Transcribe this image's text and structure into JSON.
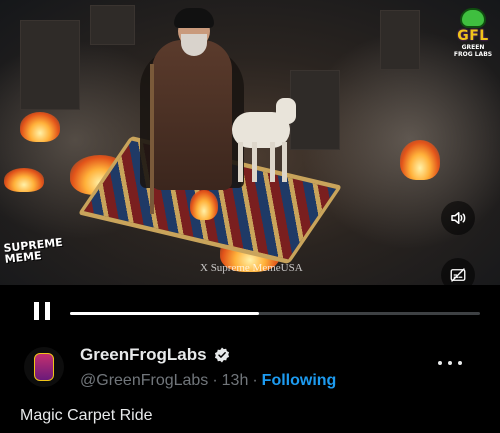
{
  "video": {
    "watermark": "X Supreme MemeUSA",
    "corner_logo": {
      "title": "GFL",
      "subtitle": "GREEN FROG LABS"
    },
    "side_logo": {
      "line1": "SUPREME",
      "line2": "MEME"
    },
    "volume_icon": "speaker-icon",
    "captions_icon": "captions-off-icon"
  },
  "player": {
    "state_icon": "pause-icon",
    "progress": 0.46
  },
  "tweet": {
    "author_name": "GreenFrogLabs",
    "handle": "@GreenFrogLabs",
    "separator": "·",
    "time": "13h",
    "follow_state": "Following",
    "text": "Magic Carpet Ride",
    "verified_color": "#e7e9ea",
    "accent_color": "#1d9bf0"
  }
}
